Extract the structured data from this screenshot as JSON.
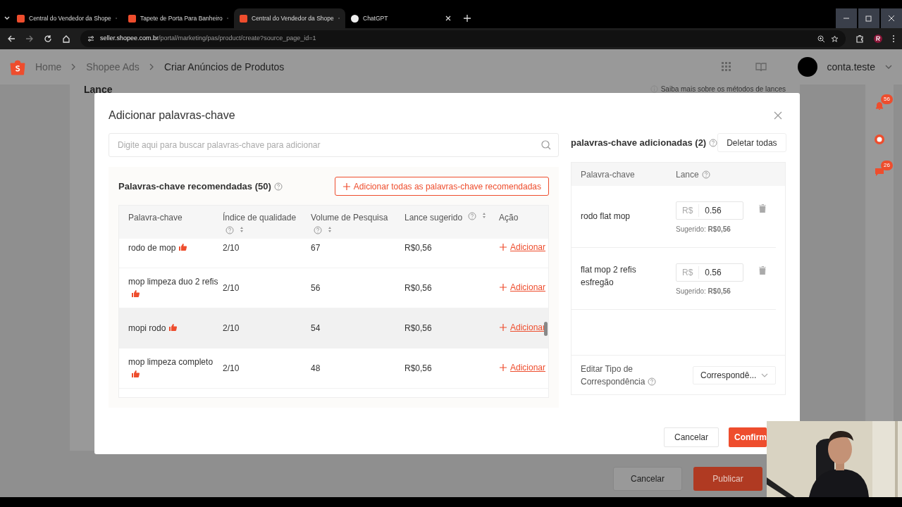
{
  "browser": {
    "tabs": [
      {
        "title": "Central do Vendedor da Shope",
        "selected": false
      },
      {
        "title": "Tapete de Porta Para Banheiro",
        "selected": false
      },
      {
        "title": "Central do Vendedor da Shope",
        "selected": true
      },
      {
        "title": "ChatGPT",
        "selected": false
      }
    ],
    "url_host": "seller.shopee.com.br",
    "url_path": "/portal/marketing/pas/product/create?source_page_id=1"
  },
  "header": {
    "breadcrumb": [
      "Home",
      "Shopee Ads",
      "Criar Anúncios de Produtos"
    ],
    "account": "conta.teste"
  },
  "page": {
    "section_title": "Lance",
    "info_link": "Saiba mais sobre os métodos de lances",
    "notification_badges": [
      "56",
      "26"
    ],
    "cancel": "Cancelar",
    "publish": "Publicar"
  },
  "modal": {
    "title": "Adicionar palavras-chave",
    "search": {
      "placeholder": "Digite aqui para buscar palavras-chave para adicionar"
    },
    "recommended": {
      "title": "Palavras-chave recomendadas (50)",
      "add_all": "Adicionar todas as palavras-chave recomendadas",
      "columns": [
        {
          "label": "Palavra-chave",
          "help": false,
          "sortable": false
        },
        {
          "label": "Índice de qualidade",
          "help": true,
          "sortable": true
        },
        {
          "label": "Volume de Pesquisa",
          "help": true,
          "sortable": true
        },
        {
          "label": "Lance sugerido",
          "help": true,
          "sortable": true
        },
        {
          "label": "Ação",
          "help": false,
          "sortable": false
        }
      ],
      "rows": [
        {
          "keyword": "rodo de mop",
          "recommended": true,
          "quality": "2/10",
          "volume": "67",
          "bid": "R$0,56",
          "action": "Adicionar",
          "highlighted": false
        },
        {
          "keyword": "mop limpeza duo 2 refis",
          "recommended": true,
          "quality": "2/10",
          "volume": "56",
          "bid": "R$0,56",
          "action": "Adicionar",
          "highlighted": false
        },
        {
          "keyword": "mopi rodo",
          "recommended": true,
          "quality": "2/10",
          "volume": "54",
          "bid": "R$0,56",
          "action": "Adicionar",
          "highlighted": true
        },
        {
          "keyword": "mop limpeza completo",
          "recommended": true,
          "quality": "2/10",
          "volume": "48",
          "bid": "R$0,56",
          "action": "Adicionar",
          "highlighted": false
        }
      ]
    },
    "added": {
      "title": "palavras-chave adicionadas (2)",
      "delete_all": "Deletar todas",
      "columns": [
        "Palavra-chave",
        "Lance"
      ],
      "rows": [
        {
          "keyword": "rodo flat mop",
          "currency": "R$",
          "bid": "0.56",
          "suggested": "Sugerido: **R$0,56**"
        },
        {
          "keyword": "flat mop 2 refis esfregão",
          "currency": "R$",
          "bid": "0.56",
          "suggested": "Sugerido: **R$0,56**"
        }
      ],
      "match_label": "Editar Tipo de Correspondência",
      "match_value": "Correspondê..."
    },
    "cancel": "Cancelar",
    "confirm": "Confirm"
  }
}
